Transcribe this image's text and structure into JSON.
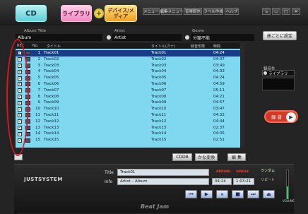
{
  "modes": {
    "cd": "CD",
    "library": "ライブラリ",
    "device": "デバイス/メディア"
  },
  "menu": [
    "メニュー",
    "編集メニュー",
    "音楽配信",
    "ラベル作成",
    "ヘルプ"
  ],
  "window_controls": [
    "↘",
    "▭",
    "□",
    "✕"
  ],
  "fields": {
    "album_label": "Album Title",
    "album_value": "Album",
    "artist_label": "Artist",
    "artist_value": "Artist",
    "genre_label": "Genre",
    "genre_value": "分類不能"
  },
  "set_button": "曲ごとに設定",
  "columns": {
    "rec": "REC",
    "no": "No.",
    "title": "タイトル",
    "kana": "タイトル(カナ)",
    "bitrate": "録音形態",
    "time": "時間"
  },
  "tracks": [
    {
      "no": "1",
      "title": "Track01",
      "kana": "Track01",
      "time": "04:24",
      "selected": true
    },
    {
      "no": "2",
      "title": "Track02",
      "kana": "Track02",
      "time": "04:07"
    },
    {
      "no": "3",
      "title": "Track03",
      "kana": "Track03",
      "time": "03:49"
    },
    {
      "no": "4",
      "title": "Track04",
      "kana": "Track04",
      "time": "04:33"
    },
    {
      "no": "5",
      "title": "Track05",
      "kana": "Track05",
      "time": "04:24"
    },
    {
      "no": "6",
      "title": "Track06",
      "kana": "Track06",
      "time": "04:59"
    },
    {
      "no": "7",
      "title": "Track07",
      "kana": "Track07",
      "time": "05:11"
    },
    {
      "no": "8",
      "title": "Track08",
      "kana": "Track08",
      "time": "04:21"
    },
    {
      "no": "9",
      "title": "Track09",
      "kana": "Track09",
      "time": "04:57"
    },
    {
      "no": "10",
      "title": "Track10",
      "kana": "Track10",
      "time": "03:47"
    },
    {
      "no": "11",
      "title": "Track11",
      "kana": "Track11",
      "time": "04:32"
    },
    {
      "no": "12",
      "title": "Track12",
      "kana": "Track12",
      "time": "04:44"
    },
    {
      "no": "13",
      "title": "Track13",
      "kana": "Track13",
      "time": "02:37"
    },
    {
      "no": "14",
      "title": "Track14",
      "kana": "Track14",
      "time": "04:05"
    },
    {
      "no": "15",
      "title": "Track15",
      "kana": "Track15",
      "time": "02:51"
    }
  ],
  "destination": {
    "label": "録音先",
    "value": "ライブラリ"
  },
  "record_button": "録 音",
  "bottom_buttons": {
    "cddb": "CDDB",
    "convert": "かな変換",
    "edit": "編 集"
  },
  "player": {
    "brand": "JUSTSYSTEM",
    "title_label": "Title",
    "title_value": "Track01",
    "info_label": "Info",
    "info_value": "Artist – Album",
    "time": "04:24",
    "total": "1:03:21",
    "random": "ランダム",
    "repeat": "リピート",
    "app_name": "Beat Jam",
    "volume_label": "VOLUME",
    "volume_level": 0.45
  },
  "indicators": {
    "left": "ARRIVAL",
    "right": "SINGLE"
  }
}
